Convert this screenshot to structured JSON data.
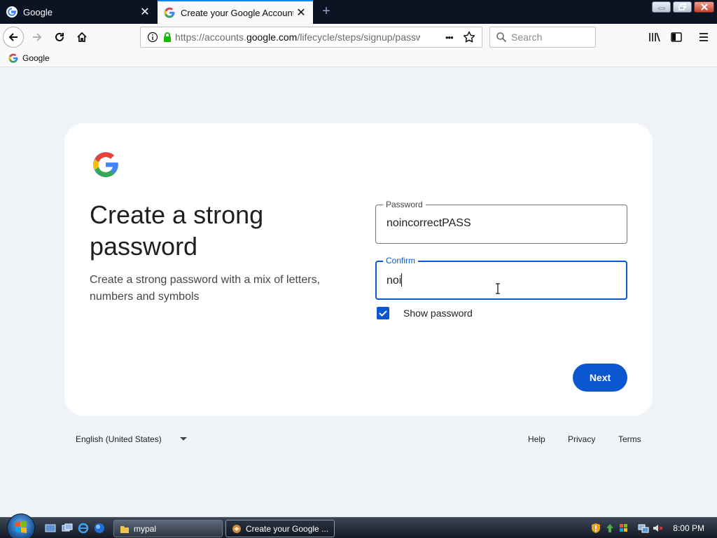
{
  "browser": {
    "tabs": [
      {
        "title": "Google",
        "active": false
      },
      {
        "title": "Create your Google Account",
        "active": true
      }
    ],
    "new_tab_label": "+",
    "url_prefix": "https://accounts.",
    "url_domain": "google.com",
    "url_rest": "/lifecycle/steps/signup/passw",
    "search_placeholder": "Search",
    "page_actions_icon": "•••",
    "bookmarks": [
      {
        "label": "Google"
      }
    ]
  },
  "page": {
    "heading": "Create a strong password",
    "subtext": "Create a strong password with a mix of letters, numbers and symbols",
    "password": {
      "label": "Password",
      "value": "noincorrectPASS"
    },
    "confirm": {
      "label": "Confirm",
      "value": "noi"
    },
    "show_password": {
      "label": "Show password",
      "checked": true
    },
    "next_label": "Next"
  },
  "footer": {
    "language": "English (United States)",
    "links": [
      "Help",
      "Privacy",
      "Terms"
    ]
  },
  "taskbar": {
    "tasks": [
      {
        "label": "mypal",
        "active": false
      },
      {
        "label": "Create your Google ...",
        "active": true
      }
    ],
    "clock": "8:00 PM"
  },
  "colors": {
    "accent": "#0b57d0",
    "page_background": "#f0f4f9",
    "tab_strip": "#0c1322"
  }
}
